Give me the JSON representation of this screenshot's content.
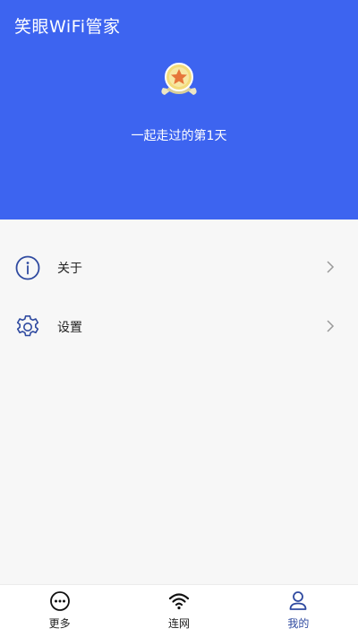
{
  "header": {
    "app_title": "笑眼WiFi管家",
    "days_text": "一起走过的第1天",
    "badge_icon": "star-medal-icon"
  },
  "menu": {
    "items": [
      {
        "label": "关于",
        "icon": "info-icon"
      },
      {
        "label": "设置",
        "icon": "gear-icon"
      }
    ]
  },
  "bottom_nav": {
    "items": [
      {
        "label": "更多",
        "icon": "more-dots-icon",
        "active": false
      },
      {
        "label": "连网",
        "icon": "wifi-icon",
        "active": false
      },
      {
        "label": "我的",
        "icon": "user-icon",
        "active": true
      }
    ]
  },
  "colors": {
    "header_bg": "#3d64f0",
    "active_nav": "#2f4aa0",
    "icon_stroke": "#2f4aa0"
  }
}
